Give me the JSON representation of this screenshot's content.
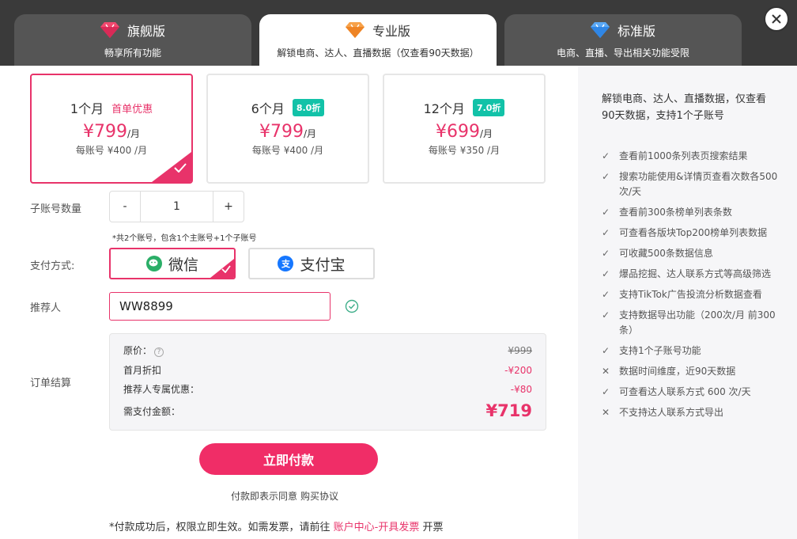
{
  "tiers": [
    {
      "title": "旗舰版",
      "subtitle": "畅享所有功能",
      "gem_color": "#f0486e"
    },
    {
      "title": "专业版",
      "subtitle": "解锁电商、达人、直播数据（仅查看90天数据）",
      "gem_color": "#f5922e"
    },
    {
      "title": "标准版",
      "subtitle": "电商、直播、导出相关功能受限",
      "gem_color": "#3d95f0"
    }
  ],
  "plans": [
    {
      "period": "1个月",
      "tag": "首单优惠",
      "price": "¥799",
      "unit": "/月",
      "per_account": "每账号 ¥400 /月",
      "selected": true
    },
    {
      "period": "6个月",
      "tag": "8.0折",
      "price": "¥799",
      "unit": "/月",
      "per_account": "每账号 ¥400 /月",
      "selected": false
    },
    {
      "period": "12个月",
      "tag": "7.0折",
      "price": "¥699",
      "unit": "/月",
      "per_account": "每账号 ¥350 /月",
      "selected": false
    }
  ],
  "form": {
    "sub_account_label": "子账号数量",
    "stepper_minus": "-",
    "stepper_value": "1",
    "stepper_plus": "+",
    "sub_account_note": "*共2个账号，包含1个主账号+1个子账号",
    "pay_label": "支付方式:",
    "pay_wechat": "微信",
    "pay_alipay": "支付宝",
    "alipay_glyph": "支",
    "referrer_label": "推荐人",
    "referrer_value": "WW8899",
    "summary_label": "订单结算"
  },
  "summary": {
    "original_label": "原价：",
    "original_value": "¥999",
    "first_month_label": "首月折扣",
    "first_month_value": "-¥200",
    "referrer_label": "推荐人专属优惠：",
    "referrer_value": "-¥80",
    "total_label": "需支付金额：",
    "total_value": "¥719"
  },
  "actions": {
    "pay_now": "立即付款",
    "agree_text": "付款即表示同意",
    "agree_link": "购买协议",
    "footer_prefix": "*付款成功后，权限立即生效。如需发票，请前往 ",
    "footer_link": "账户中心-开具发票",
    "footer_suffix": " 开票"
  },
  "sidebar": {
    "intro": "解锁电商、达人、直播数据，仅查看90天数据，支持1个子账号",
    "features": [
      {
        "mark": "check",
        "text": "查看前1000条列表页搜索结果"
      },
      {
        "mark": "check",
        "text": "搜索功能使用&详情页查看次数各500次/天"
      },
      {
        "mark": "check",
        "text": "查看前300条榜单列表条数"
      },
      {
        "mark": "check",
        "text": "可查看各版块Top200榜单列表数据"
      },
      {
        "mark": "check",
        "text": "可收藏500条数据信息"
      },
      {
        "mark": "check",
        "text": "爆品挖掘、达人联系方式等高级筛选"
      },
      {
        "mark": "check",
        "text": "支持TikTok广告投流分析数据查看"
      },
      {
        "mark": "check",
        "text": "支持数据导出功能（200次/月 前300条）"
      },
      {
        "mark": "check",
        "text": "支持1个子账号功能"
      },
      {
        "mark": "cross",
        "text": "数据时间维度，近90天数据"
      },
      {
        "mark": "check",
        "text": "可查看达人联系方式 600 次/天"
      },
      {
        "mark": "cross",
        "text": "不支持达人联系方式导出"
      }
    ]
  },
  "colors": {
    "accent": "#e8336a",
    "discount_badge": "#12c2a8",
    "wechat": "#2aae67",
    "alipay": "#1677ff"
  }
}
